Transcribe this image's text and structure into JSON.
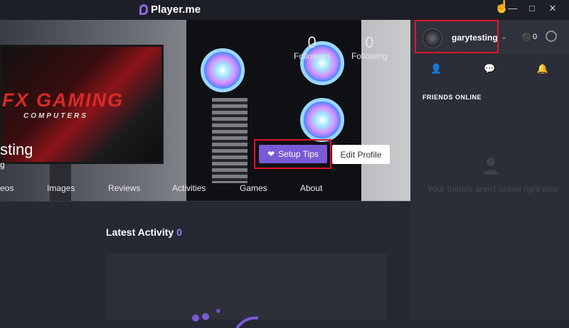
{
  "app": {
    "name": "Player.me"
  },
  "window": {
    "controls": [
      "minimize",
      "maximize",
      "close"
    ]
  },
  "profile": {
    "name": "sting",
    "subtitle": "g",
    "followers_count": "0",
    "followers_label": "Followers",
    "following_count": "0",
    "following_label": "Following",
    "banner_brand_line1": "FX GAMING",
    "banner_brand_line2": "COMPUTERS",
    "setup_tips_label": "Setup Tips",
    "edit_profile_label": "Edit Profile",
    "tabs": [
      "eos",
      "Images",
      "Reviews",
      "Activities",
      "Games",
      "About"
    ]
  },
  "feed": {
    "title": "Latest Activity",
    "count": "0"
  },
  "sidebar": {
    "username": "garytesting",
    "coins": "0",
    "tabs": [
      "friends-icon",
      "messages-icon",
      "notifications-icon"
    ],
    "friends_online_label": "FRIENDS ONLINE",
    "empty_message": "Your friends aren't online right now"
  },
  "colors": {
    "accent": "#7a59d6",
    "highlight": "#e0132a",
    "background": "#262933",
    "sidebar": "#2b2e38"
  }
}
